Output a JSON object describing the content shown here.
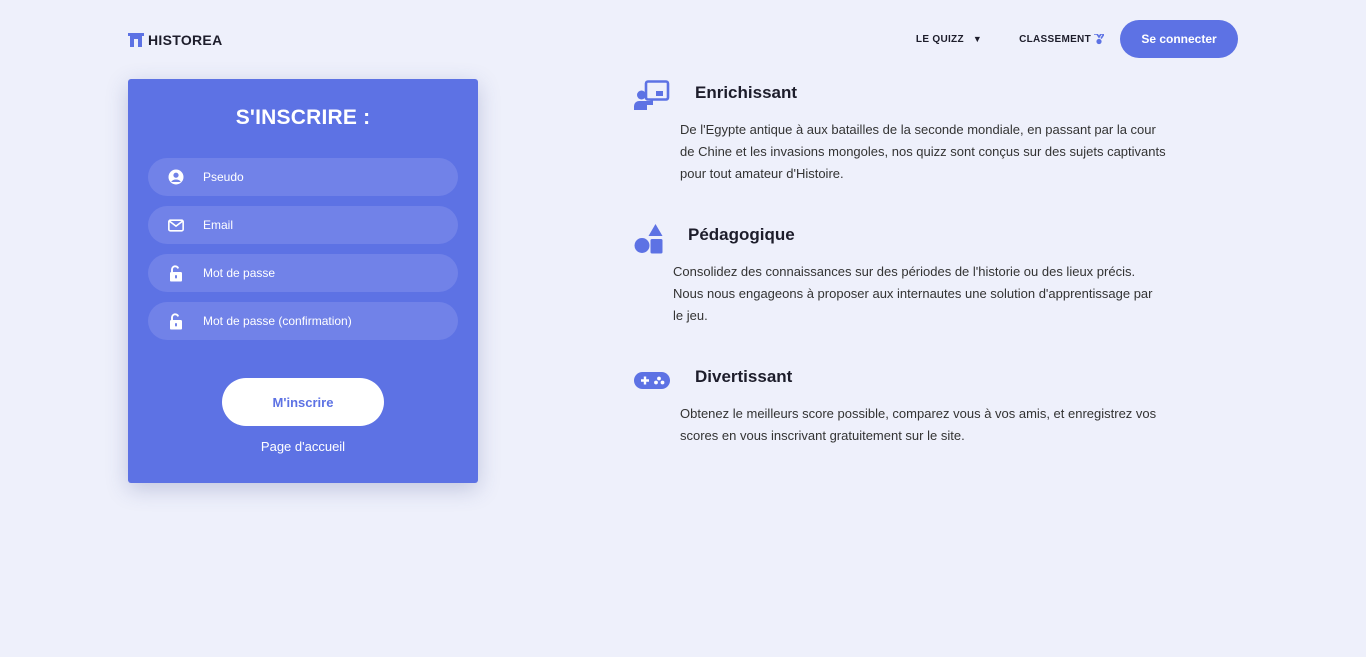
{
  "brand": {
    "name": "HISTOREA",
    "accent": "#5d72e4",
    "background": "#eef0fb"
  },
  "nav": {
    "quiz_label": "LE QUIZZ",
    "ranking_label": "CLASSEMENT",
    "login_label": "Se connecter"
  },
  "register": {
    "title": "S'INSCRIRE :",
    "fields": [
      {
        "icon": "user-circle-icon",
        "placeholder": "Pseudo",
        "value": ""
      },
      {
        "icon": "envelope-icon",
        "placeholder": "Email",
        "value": ""
      },
      {
        "icon": "unlock-icon",
        "placeholder": "Mot de passe",
        "value": ""
      },
      {
        "icon": "unlock-icon",
        "placeholder": "Mot de passe (confirmation)",
        "value": ""
      }
    ],
    "submit_label": "M'inscrire",
    "home_link": "Page d'accueil"
  },
  "features": [
    {
      "icon": "teacher-board-icon",
      "title": "Enrichissant",
      "text": "De l'Egypte antique à aux batailles de la seconde mondiale, en passant par la cour de Chine et les invasions mongoles, nos quizz sont conçus sur des sujets captivants pour tout amateur d'Histoire."
    },
    {
      "icon": "shapes-icon",
      "title": "Pédagogique",
      "text": "Consolidez des connaissances sur des périodes de l'historie ou des lieux précis. Nous nous engageons à proposer aux internautes une solution d'apprentissage par le jeu."
    },
    {
      "icon": "gamepad-icon",
      "title": "Divertissant",
      "text": "Obtenez le meilleurs score possible, comparez vous à vos amis, et enregistrez vos scores en vous inscrivant gratuitement sur le site."
    }
  ]
}
